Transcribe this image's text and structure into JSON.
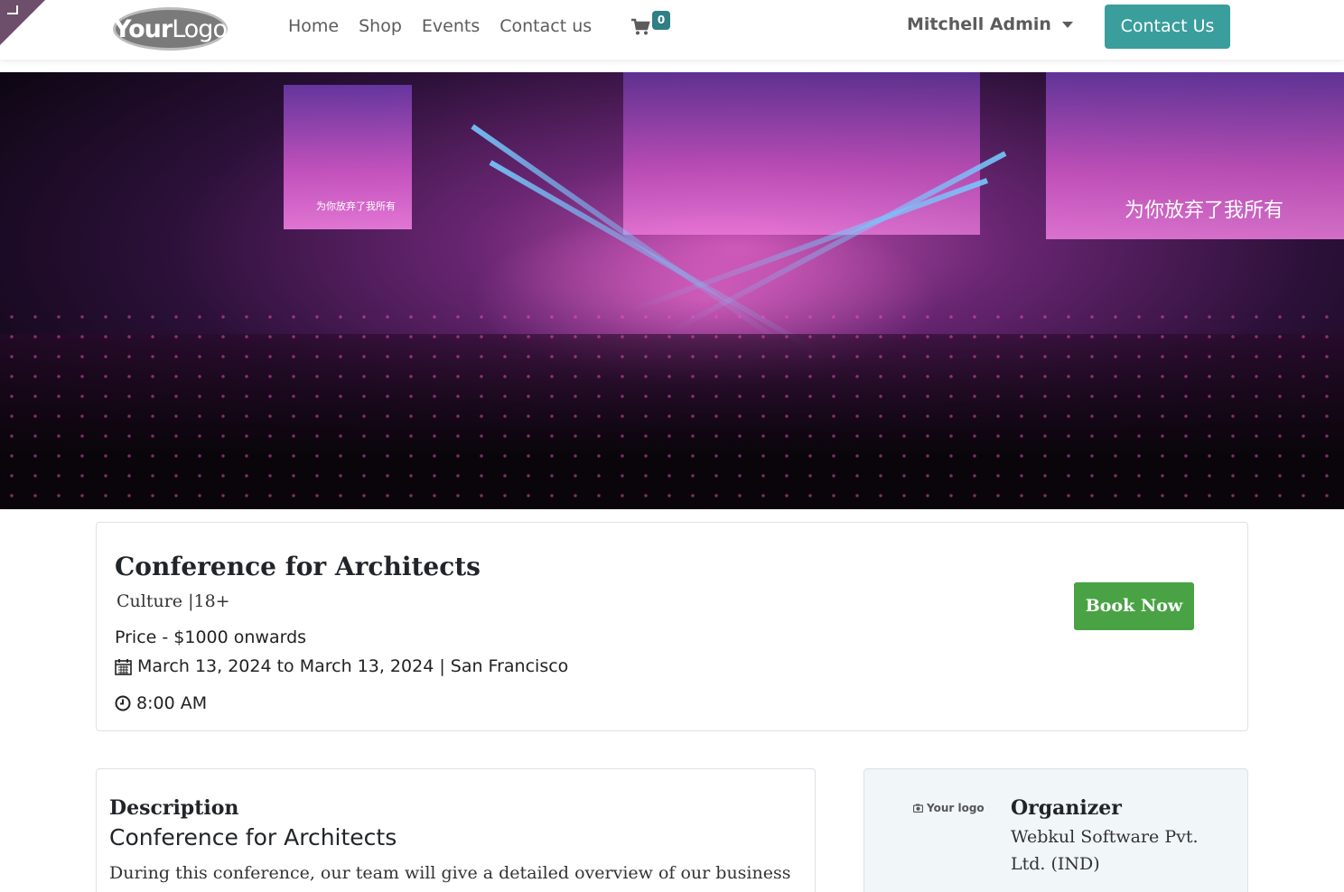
{
  "header": {
    "logo": {
      "bold": "Your",
      "thin": "Logo"
    },
    "nav": [
      "Home",
      "Shop",
      "Events",
      "Contact us"
    ],
    "cart_count": "0",
    "user_name": "Mitchell Admin",
    "contact_button": "Contact Us"
  },
  "hero": {
    "caption_small": "为你放弃了我所有",
    "caption_big": "为你放弃了我所有"
  },
  "event": {
    "title": "Conference for Architects",
    "tags": "Culture |18+",
    "price": "Price - $1000 onwards",
    "date": "March 13, 2024 to March 13, 2024 | San Francisco",
    "time": "8:00 AM",
    "book_button": "Book Now"
  },
  "description": {
    "heading": "Description",
    "title": "Conference for Architects",
    "body": "During this conference, our team will give a detailed overview of our business"
  },
  "organizer": {
    "logo_text": "Your logo",
    "heading": "Organizer",
    "name": "Webkul Software Pvt. Ltd. (IND)"
  },
  "colors": {
    "accent": "#3a9e9d",
    "cart_badge": "#2f7f85",
    "book_button": "#49a344",
    "corner_tag": "#6e4f6b"
  }
}
